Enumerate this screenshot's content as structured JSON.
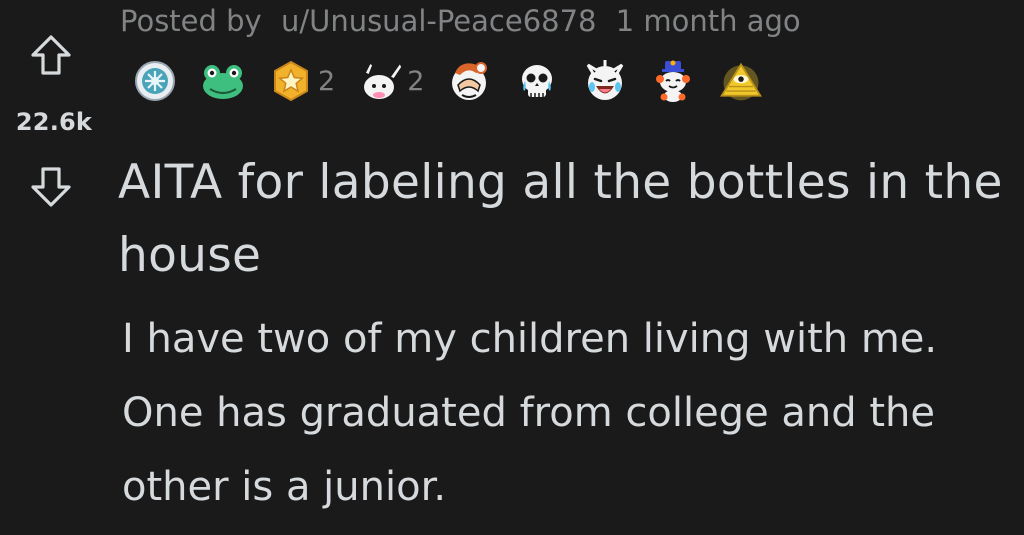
{
  "post": {
    "score": "22.6k",
    "posted_by_prefix": "Posted by",
    "author": "u/Unusual-Peace6878",
    "time": "1 month ago",
    "title": "AITA for labeling all the bottles in the house",
    "body": "I have two of my children living with me. One has graduated from college and the other is a junior."
  },
  "awards": [
    {
      "icon": "silver-badge-icon",
      "count": ""
    },
    {
      "icon": "frog-icon",
      "count": ""
    },
    {
      "icon": "star-medal-icon",
      "count": "2"
    },
    {
      "icon": "praise-hands-icon",
      "count": "2"
    },
    {
      "icon": "facepalm-icon",
      "count": ""
    },
    {
      "icon": "crying-skull-icon",
      "count": ""
    },
    {
      "icon": "laughing-face-icon",
      "count": ""
    },
    {
      "icon": "snoo-party-icon",
      "count": ""
    },
    {
      "icon": "illuminati-pyramid-icon",
      "count": ""
    }
  ],
  "colors": {
    "background": "#1a1a1b",
    "text": "#d7dadc",
    "meta": "#818384"
  }
}
